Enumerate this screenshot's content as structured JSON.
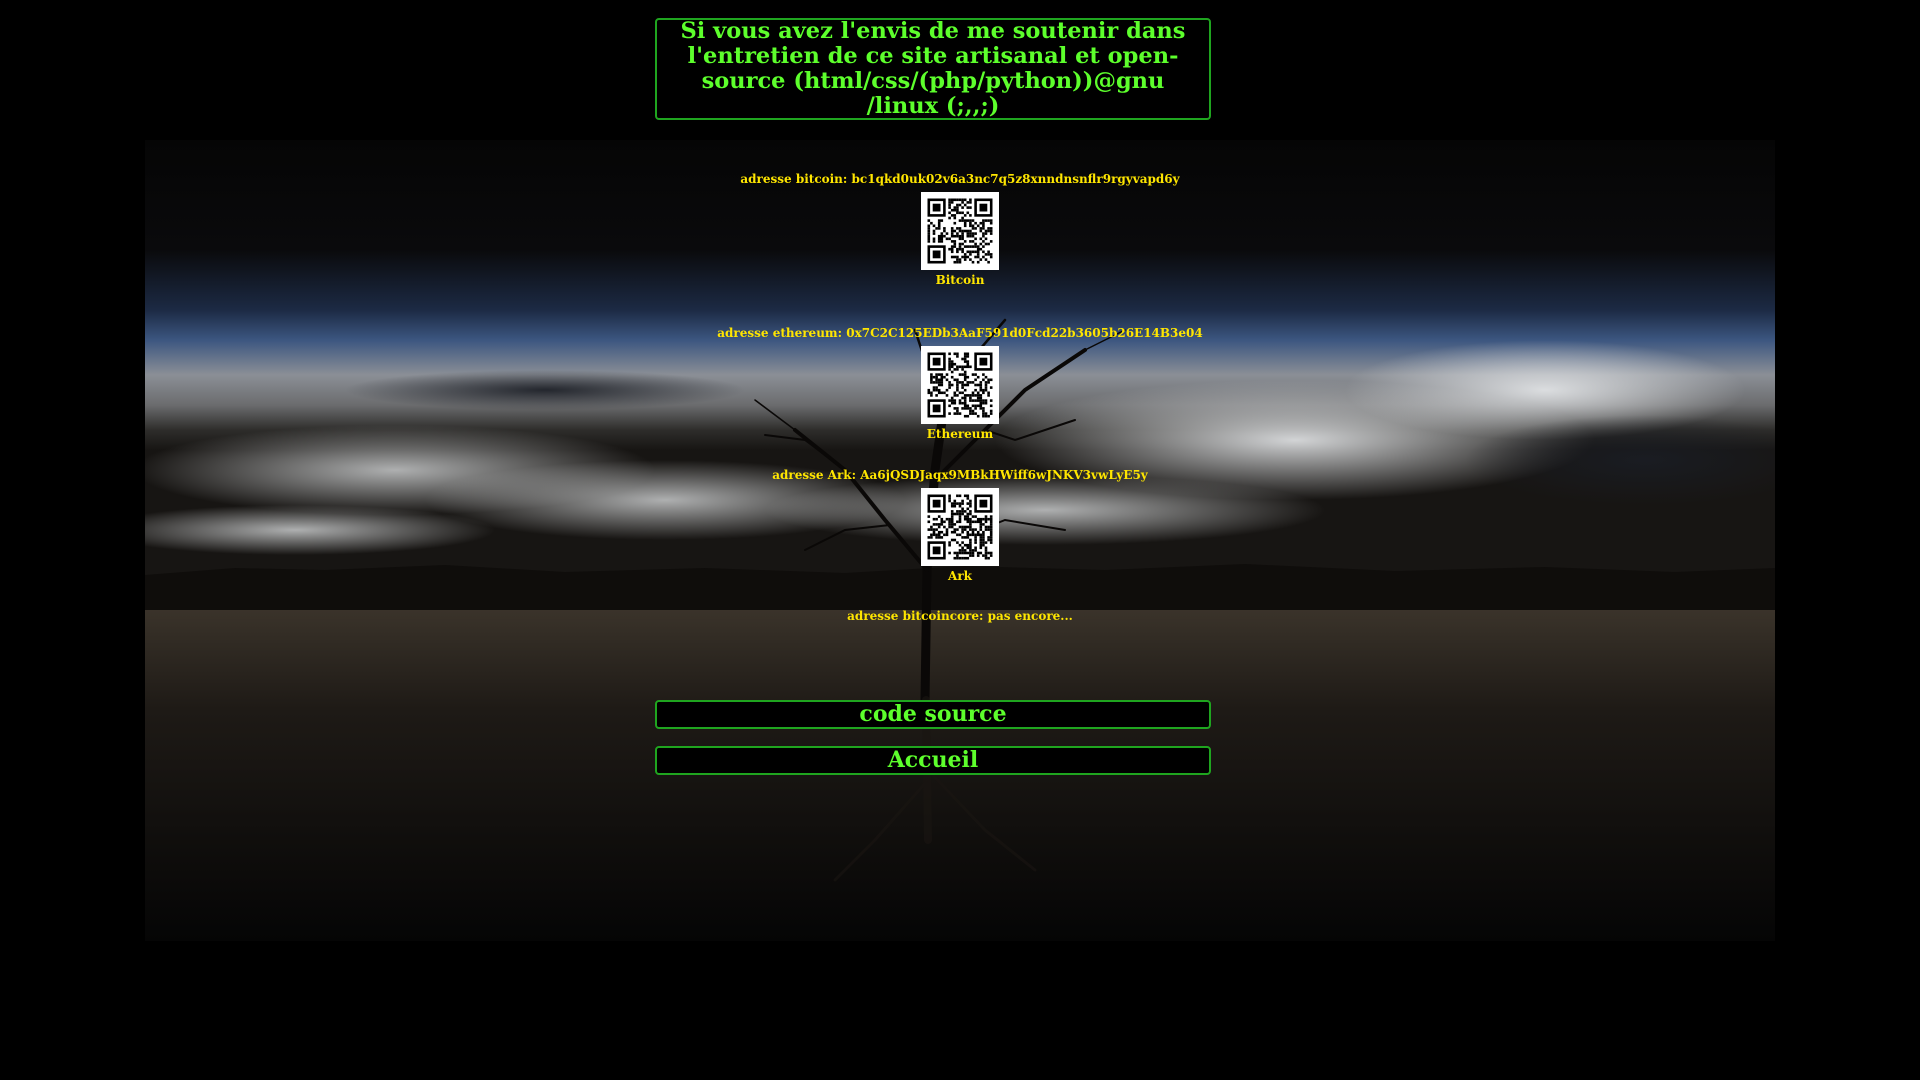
{
  "header": {
    "text": "Si vous avez l'envis de me soutenir dans l'entretien de ce site artisanal et open-source (html/css/(php/python))@gnu /linux (;,,;)"
  },
  "colors": {
    "accent_green": "#5dff2c",
    "border_green": "#1fa51f",
    "label_yellow": "#ffe600",
    "background": "#000000"
  },
  "donations": [
    {
      "address_text": "adresse bitcoin: bc1qkd0uk02v6a3nc7q5z8xnndnsnflr9rgyvapd6y",
      "name": "Bitcoin",
      "icon": "qr-code-icon"
    },
    {
      "address_text": "adresse ethereum: 0x7C2C125EDb3AaF591d0Fcd22b3605b26E14B3e04",
      "name": "Ethereum",
      "icon": "qr-code-icon"
    },
    {
      "address_text": "adresse Ark: Aa6jQSDJaqx9MBkHWiff6wJNKV3vwLyE5y",
      "name": "Ark",
      "icon": "qr-code-icon"
    }
  ],
  "bitcoincore": {
    "text": "adresse bitcoincore: pas encore..."
  },
  "buttons": {
    "source": "code source",
    "home": "Accueil"
  }
}
